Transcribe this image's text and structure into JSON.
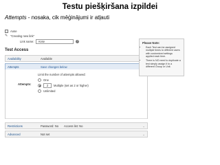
{
  "slide": {
    "title": "Testu piešķiršana izpildei",
    "subtitle_term": "Attempts",
    "subtitle_rest": " - nosaka, cik mēģinājumi ir atļauti"
  },
  "breadcrumb": {
    "course": "Aose",
    "page": "\"Creating new link\""
  },
  "link": {
    "label": "Link name:",
    "value": "Aose"
  },
  "section_title": "Test Access",
  "note": {
    "title": "Please Note:",
    "items": [
      "Each Test can be assigned multiple times to different users with customized settings applied each time.",
      "There is NO need to duplicate a test simply assign it to a different Group or Unit."
    ]
  },
  "rows": {
    "availability": {
      "label": "Availability",
      "value": "Available"
    },
    "attempts": {
      "label": "Attempts",
      "value": "Save changes below"
    },
    "restrictions": {
      "label": "Restrictions",
      "value": "Password: No",
      "value2": "Access list: No"
    },
    "advanced": {
      "label": "Advanced",
      "value": "Not set"
    }
  },
  "attempts_panel": {
    "instruction": "Limit the number of attempts allowed:",
    "field_label": "Attempts:",
    "options": [
      {
        "label": "One",
        "selected": false
      },
      {
        "value": "2",
        "label": "Multiple (set as 2 or higher)",
        "selected": true
      },
      {
        "label": "Unlimited",
        "selected": false
      }
    ]
  }
}
